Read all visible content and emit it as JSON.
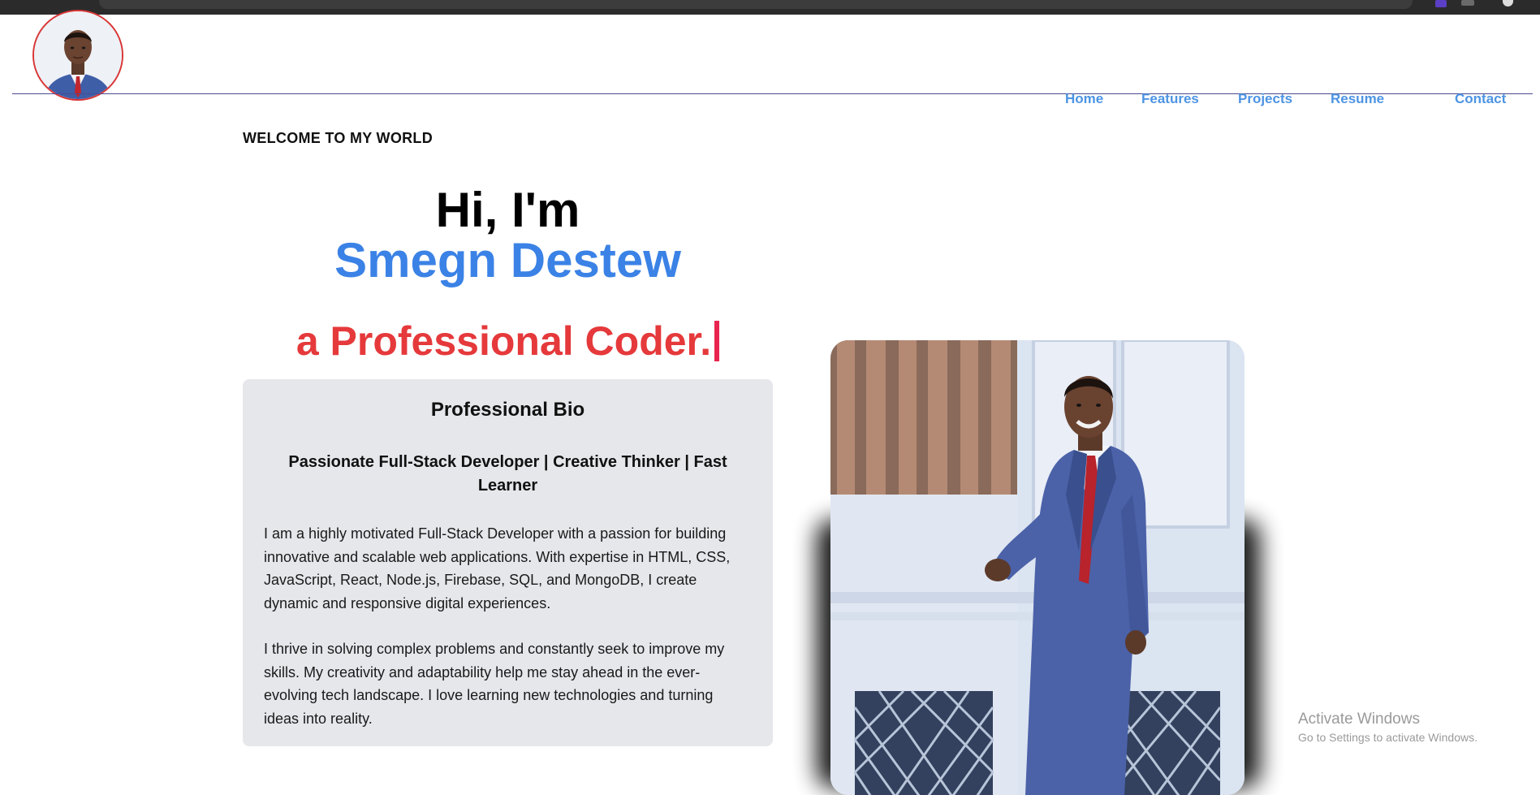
{
  "nav": {
    "home": "Home",
    "features": "Features",
    "projects": "Projects",
    "resume": "Resume",
    "contact": "Contact"
  },
  "hero": {
    "welcome": "WELCOME TO MY WORLD",
    "greeting": "Hi, I'm",
    "name": "Smegn Destew",
    "typed": "a Professional Coder."
  },
  "bio": {
    "title": "Professional Bio",
    "subtitle": "Passionate Full-Stack Developer | Creative Thinker | Fast Learner",
    "paragraph1": "I am a highly motivated Full-Stack Developer with a passion for building innovative and scalable web applications. With expertise in HTML, CSS, JavaScript, React, Node.js, Firebase, SQL, and MongoDB, I create dynamic and responsive digital experiences.",
    "paragraph2": "I thrive in solving complex problems and constantly seek to improve my skills. My creativity and adaptability help me stay ahead in the ever-evolving tech landscape. I love learning new technologies and turning ideas into reality."
  },
  "watermark": {
    "line1": "Activate Windows",
    "line2": "Go to Settings to activate Windows."
  },
  "colors": {
    "nav_link": "#4d94e3",
    "name_accent": "#3b82e6",
    "typed_accent": "#e5393b",
    "cursor": "#e8244f",
    "card_bg": "#e5e7eb"
  },
  "icons": {
    "avatar": "profile-avatar-image",
    "portrait": "profile-portrait-photo"
  }
}
